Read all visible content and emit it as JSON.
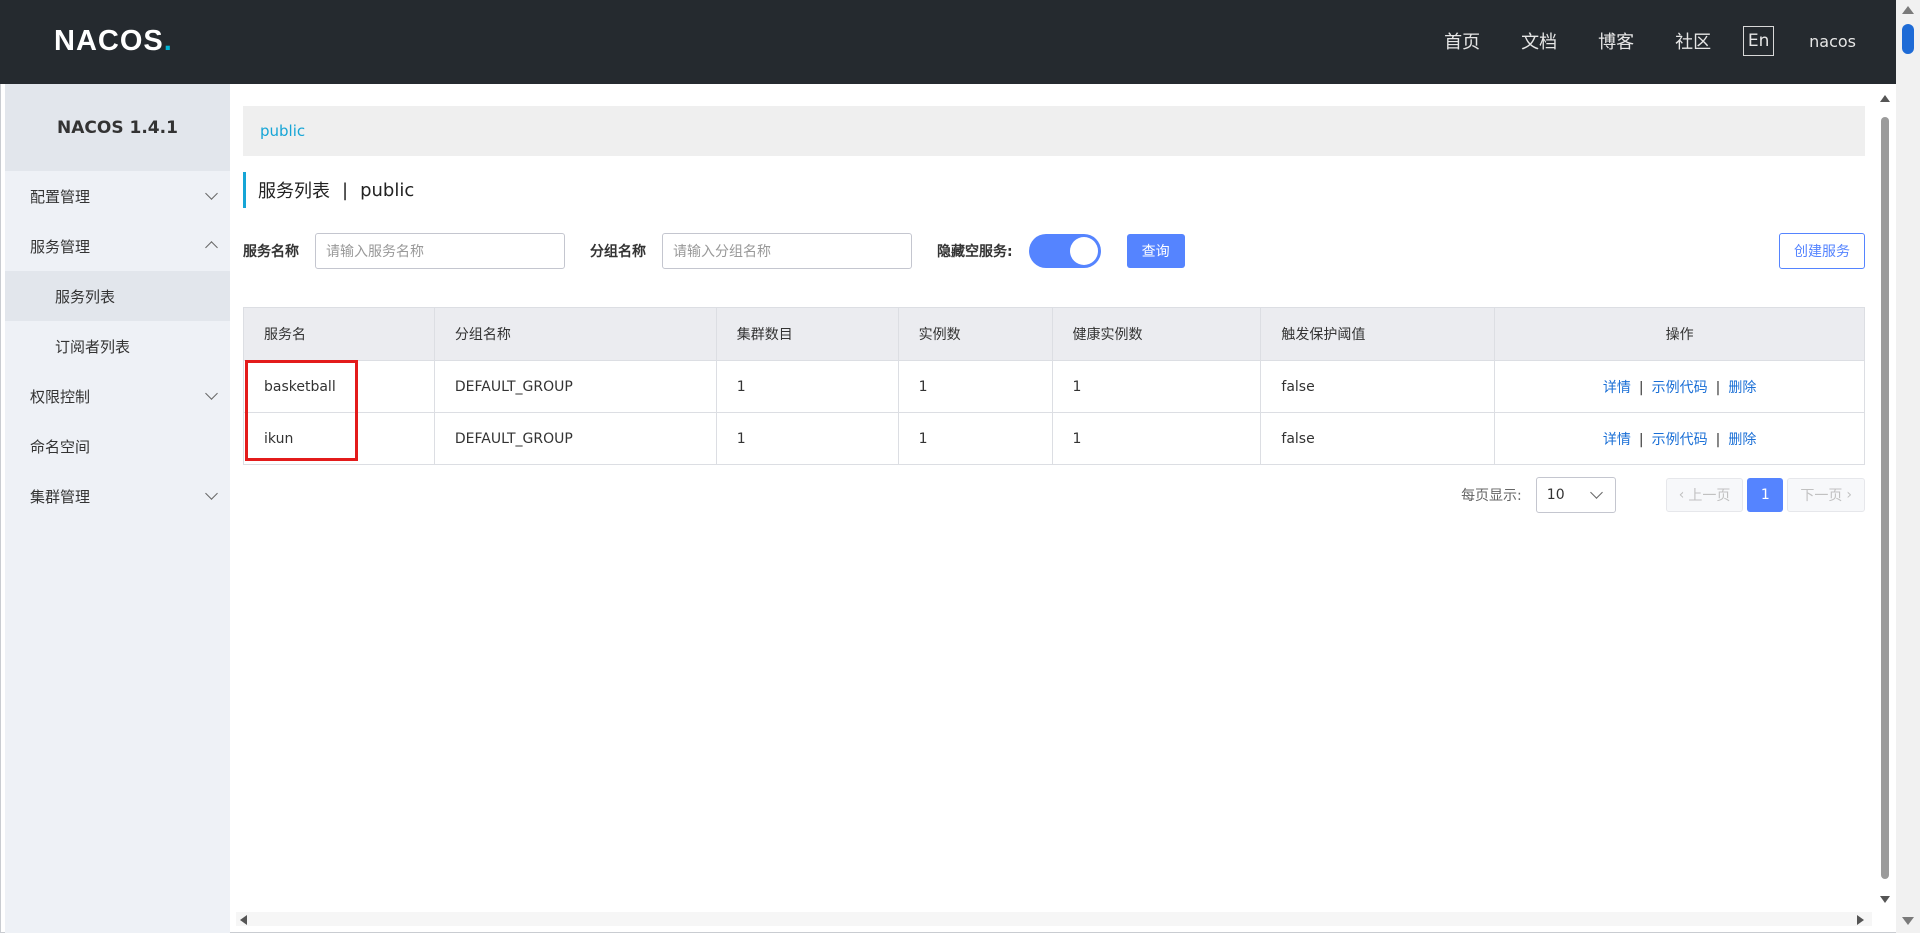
{
  "header": {
    "logo_text": "NACOS",
    "logo_dot": ".",
    "nav": [
      "首页",
      "文档",
      "博客",
      "社区"
    ],
    "lang": "En",
    "user": "nacos"
  },
  "sidebar": {
    "title": "NACOS 1.4.1",
    "items": [
      {
        "label": "配置管理"
      },
      {
        "label": "服务管理"
      },
      {
        "label": "服务列表"
      },
      {
        "label": "订阅者列表"
      },
      {
        "label": "权限控制"
      },
      {
        "label": "命名空间"
      },
      {
        "label": "集群管理"
      }
    ]
  },
  "namespace": {
    "current": "public"
  },
  "page": {
    "title": "服务列表",
    "sep": "|",
    "namespace": "public"
  },
  "filters": {
    "service_label": "服务名称",
    "service_placeholder": "请输入服务名称",
    "group_label": "分组名称",
    "group_placeholder": "请输入分组名称",
    "hide_empty_label": "隐藏空服务:",
    "query": "查询",
    "create": "创建服务"
  },
  "table": {
    "columns": [
      "服务名",
      "分组名称",
      "集群数目",
      "实例数",
      "健康实例数",
      "触发保护阈值",
      "操作"
    ],
    "rows": [
      {
        "name": "basketball",
        "group": "DEFAULT_GROUP",
        "clusters": "1",
        "instances": "1",
        "healthy": "1",
        "threshold": "false"
      },
      {
        "name": "ikun",
        "group": "DEFAULT_GROUP",
        "clusters": "1",
        "instances": "1",
        "healthy": "1",
        "threshold": "false"
      }
    ],
    "ops": {
      "detail": "详情",
      "sample": "示例代码",
      "delete": "删除",
      "sep": "|"
    }
  },
  "pagination": {
    "label": "每页显示:",
    "page_size": "10",
    "prev": "上一页",
    "current": "1",
    "next": "下一页"
  },
  "colors": {
    "header_bg": "#252a2f",
    "accent": "#5584ff",
    "link": "#16a5d6",
    "highlight": "#e31b1b"
  }
}
